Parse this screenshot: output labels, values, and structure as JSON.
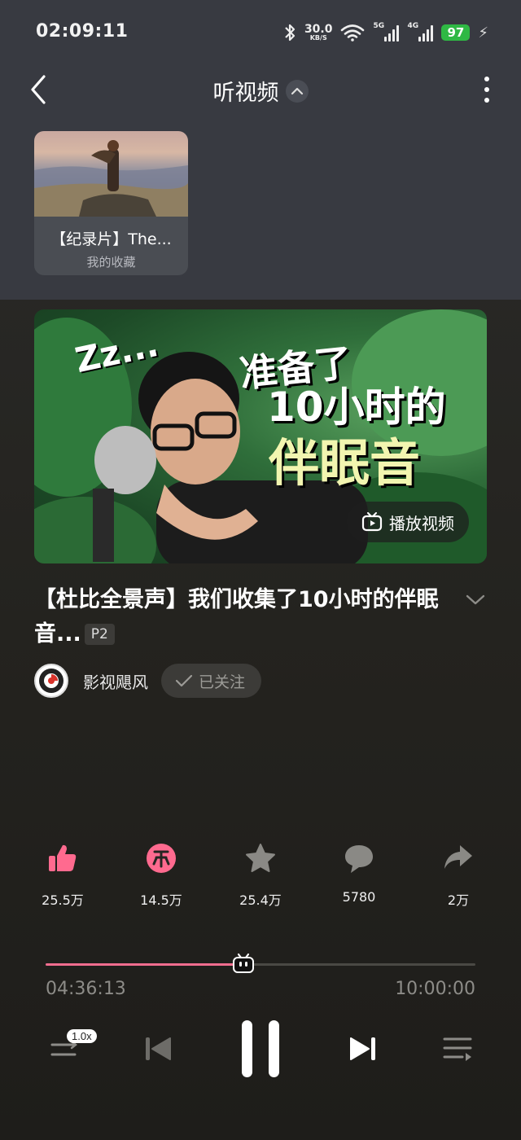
{
  "status": {
    "time": "02:09:11",
    "net_speed_value": "30.0",
    "net_speed_unit": "KB/S",
    "sig1_label": "5G",
    "sig2_label": "4G",
    "battery": "97"
  },
  "header": {
    "back_icon": "chevron-left-icon",
    "title": "听视频",
    "title_chevron_icon": "chevron-up-icon",
    "more_icon": "more-vertical-icon"
  },
  "card": {
    "title": "【纪录片】The...",
    "subtitle": "我的收藏"
  },
  "cover": {
    "play_video_label": "播放视频",
    "text_lines": [
      "Zz...",
      "准备了",
      "10小时的",
      "伴眠音"
    ]
  },
  "video": {
    "title": "【杜比全景声】我们收集了10小时的伴眠音...",
    "part_badge": "P2"
  },
  "author": {
    "name": "影视飓风",
    "follow_label": "已关注"
  },
  "actions": [
    {
      "icon": "thumbs-up-icon",
      "count": "25.5万",
      "color": "#ff6a8f"
    },
    {
      "icon": "coin-icon",
      "count": "14.5万",
      "color": "#ff6a8f"
    },
    {
      "icon": "star-icon",
      "count": "25.4万",
      "color": "#8a8985"
    },
    {
      "icon": "comment-icon",
      "count": "5780",
      "color": "#8a8985"
    },
    {
      "icon": "share-icon",
      "count": "2万",
      "color": "#8a8985"
    }
  ],
  "playback": {
    "current_time": "04:36:13",
    "total_time": "10:00:00",
    "progress": 0.4601,
    "speed": "1.0x"
  },
  "colors": {
    "accent": "#f06d8f",
    "top_panel": "#383a41",
    "background": "#24231f"
  }
}
